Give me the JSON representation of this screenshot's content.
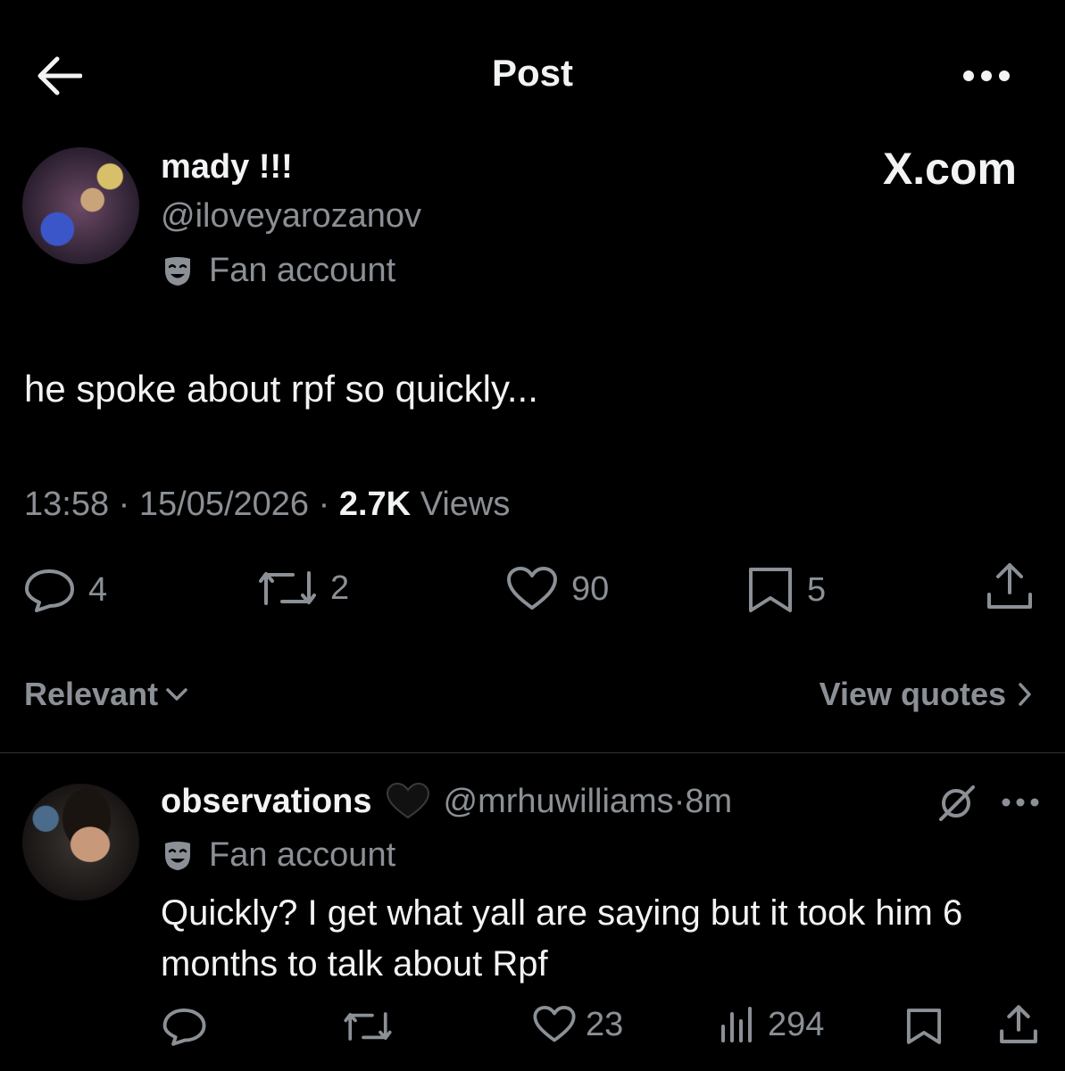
{
  "header": {
    "title": "Post"
  },
  "post": {
    "author_name": "mady !!!",
    "author_handle": "@iloveyarozanov",
    "author_badge": "Fan account",
    "brand": "X.com",
    "text": "he spoke about rpf so quickly...",
    "time": "13:58",
    "date": "15/05/2026",
    "views_count": "2.7K",
    "views_label": "Views",
    "replies": "4",
    "reposts": "2",
    "likes": "90",
    "bookmarks": "5"
  },
  "replies_bar": {
    "sort_label": "Relevant",
    "view_quotes_label": "View quotes"
  },
  "reply": {
    "author_name": "observations",
    "author_handle": "@mrhuwilliams",
    "age": "8m",
    "author_badge": "Fan account",
    "text": "Quickly? I get what yall are saying but it took him 6 months to talk about Rpf",
    "likes": "23",
    "views": "294"
  },
  "colors": {
    "background": "#000000",
    "text": "#e7e9ea",
    "muted": "#8b9096",
    "divider": "#2f3336"
  }
}
